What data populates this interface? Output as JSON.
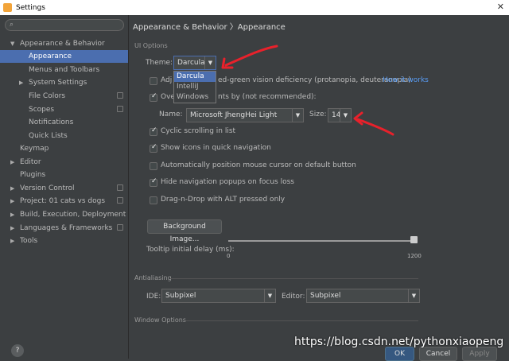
{
  "window": {
    "title": "Settings"
  },
  "sidebar": {
    "items": [
      {
        "label": "Appearance & Behavior",
        "expanded": true
      },
      {
        "label": "Appearance"
      },
      {
        "label": "Menus and Toolbars"
      },
      {
        "label": "System Settings",
        "expanded": false
      },
      {
        "label": "File Colors"
      },
      {
        "label": "Scopes"
      },
      {
        "label": "Notifications"
      },
      {
        "label": "Quick Lists"
      },
      {
        "label": "Keymap"
      },
      {
        "label": "Editor",
        "expanded": false
      },
      {
        "label": "Plugins"
      },
      {
        "label": "Version Control",
        "expanded": false
      },
      {
        "label": "Project: 01 cats vs dogs",
        "expanded": false
      },
      {
        "label": "Build, Execution, Deployment",
        "expanded": false
      },
      {
        "label": "Languages & Frameworks",
        "expanded": false
      },
      {
        "label": "Tools",
        "expanded": false
      }
    ],
    "help": "?"
  },
  "main": {
    "breadcrumb": "Appearance & Behavior 〉Appearance",
    "ui_options": "UI Options",
    "theme_label": "Theme:",
    "theme_value": "Darcula",
    "theme_options": [
      "Darcula",
      "IntelliJ",
      "Windows"
    ],
    "adjust_prefix": "Adj",
    "adjust_text": "ed-green vision deficiency (protanopia, deuteranopia)",
    "how_it_works": "How it works",
    "override_prefix": "Ove",
    "override_text": "nts by (not recommended):",
    "name_label": "Name:",
    "font_value": "Microsoft JhengHei Light",
    "size_label": "Size:",
    "size_value": "14",
    "cyclic": "Cyclic scrolling in list",
    "show_icons": "Show icons in quick navigation",
    "auto_pos": "Automatically position mouse cursor on default button",
    "hide_nav": "Hide navigation popups on focus loss",
    "drag_drop": "Drag-n-Drop with ALT pressed only",
    "bg_image": "Background Image...",
    "tooltip_label": "Tooltip initial delay (ms):",
    "slider_min": "0",
    "slider_max": "1200",
    "antialiasing": "Antialiasing",
    "ide_label": "IDE:",
    "ide_value": "Subpixel",
    "editor_label": "Editor:",
    "editor_value": "Subpixel",
    "window_options": "Window Options",
    "ok": "OK",
    "cancel": "Cancel",
    "apply": "Apply"
  },
  "watermark": "https://blog.csdn.net/pythonxiaopeng",
  "colors": {
    "selection": "#4b6eaf",
    "annotation": "#e8212b",
    "link": "#589df6"
  }
}
